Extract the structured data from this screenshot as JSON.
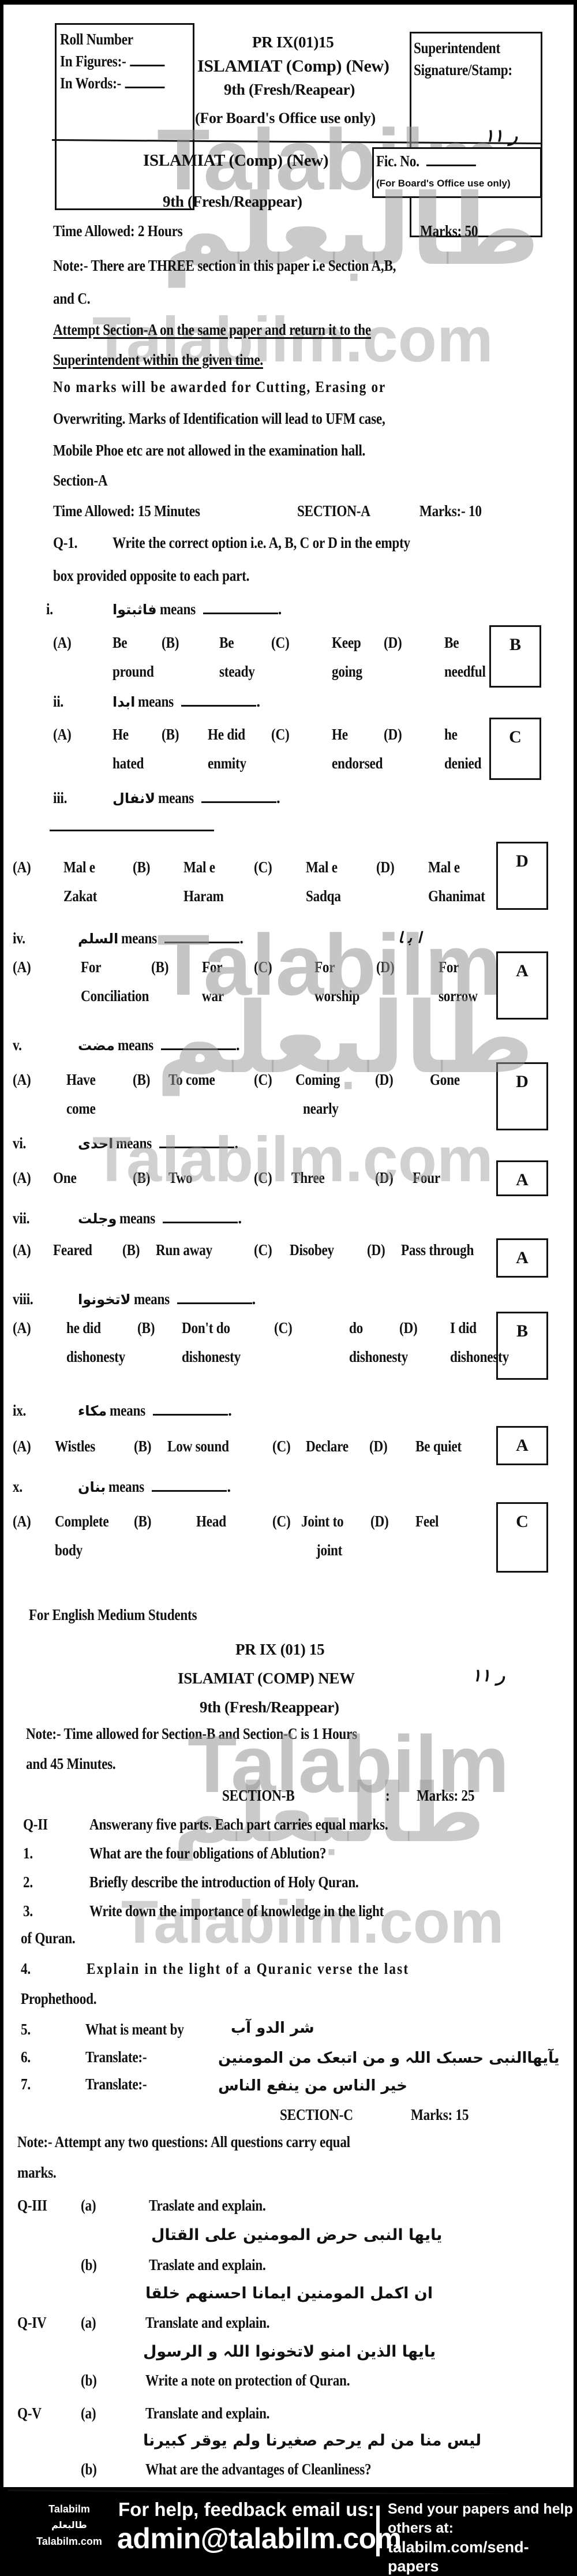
{
  "header": {
    "roll_box": {
      "title": "Roll Number",
      "figures_label": "In Figures:-",
      "words_label": "In Words:-"
    },
    "paper_code": "PR IX(01)15",
    "subject": "ISLAMIAT (Comp) (New)",
    "class": "9th (Fresh/Reapear)",
    "office_note": "(For Board's Office use only)",
    "superintendent_box": {
      "line1": "Superintendent",
      "line2": "Signature/Stamp:"
    },
    "handwritten_mark": "ﺭ ۱۱"
  },
  "section_a_header": {
    "subject": "ISLAMIAT (Comp) (New)",
    "class": "9th (Fresh/Reappear)",
    "fic_box": {
      "label": "Fic. No.",
      "note": "(For Board's Office use only)"
    },
    "time_allowed": "Time Allowed: 2 Hours",
    "marks": "Marks: 50",
    "note_line1": "Note:-  There are THREE section in this paper i.e Section A,B,",
    "note_line2": "and C.",
    "attempt_line1": "Attempt Section-A on the same paper and return it to the",
    "attempt_line2": "Superintendent within the given time.",
    "rules_line1": "No marks will be awarded for Cutting, Erasing or",
    "rules_line2": "Overwriting. Marks of Identification will lead to UFM case,",
    "rules_line3": "Mobile Phoe etc are not allowed in the examination hall.",
    "section_label": "Section-A",
    "section_time": "Time Allowed: 15 Minutes",
    "section_title": "SECTION-A",
    "section_marks": "Marks:- 10",
    "q1_num": "Q-1.",
    "q1_line1": "Write the correct option i.e. A, B, C or D in the empty",
    "q1_line2": "box provided opposite to each part."
  },
  "mcqs": [
    {
      "num": "i.",
      "arabic": "فاثبتوا",
      "means": "means",
      "options": [
        [
          "(A)",
          "Be",
          "pround"
        ],
        [
          "(B)",
          "Be",
          "steady"
        ],
        [
          "(C)",
          "Keep",
          "going"
        ],
        [
          "(D)",
          "Be",
          "needful"
        ]
      ],
      "answer": "B"
    },
    {
      "num": "ii.",
      "arabic": "ابدا",
      "means": "means",
      "options": [
        [
          "(A)",
          "He",
          "hated"
        ],
        [
          "(B)",
          "He did",
          "enmity"
        ],
        [
          "(C)",
          "He",
          "endorsed"
        ],
        [
          "(D)",
          "he",
          "denied"
        ]
      ],
      "answer": "C"
    },
    {
      "num": "iii.",
      "arabic": "لانفال",
      "means": "means",
      "options": [
        [
          "(A)",
          "Mal e",
          "Zakat"
        ],
        [
          "(B)",
          "Mal e",
          "Haram"
        ],
        [
          "(C)",
          "Mal e",
          "Sadqa"
        ],
        [
          "(D)",
          "Mal e",
          "Ghanimat"
        ]
      ],
      "answer": "D"
    },
    {
      "num": "iv.",
      "arabic": "السلم",
      "means": "means",
      "options": [
        [
          "(A)",
          "For",
          "Conciliation"
        ],
        [
          "(B)",
          "For",
          "war"
        ],
        [
          "(C)",
          "For",
          "worship"
        ],
        [
          "(D)",
          "For",
          "sorrow"
        ]
      ],
      "answer": "A"
    },
    {
      "num": "v.",
      "arabic": "مضت",
      "means": "means",
      "options": [
        [
          "(A)",
          "Have",
          "come"
        ],
        [
          "(B)",
          "To come",
          ""
        ],
        [
          "(C)",
          "Coming",
          "nearly"
        ],
        [
          "(D)",
          "Gone",
          ""
        ]
      ],
      "answer": "D"
    },
    {
      "num": "vi.",
      "arabic": "احدی",
      "means": "means",
      "options": [
        [
          "(A)",
          "One",
          ""
        ],
        [
          "(B)",
          "Two",
          ""
        ],
        [
          "(C)",
          "Three",
          ""
        ],
        [
          "(D)",
          "Four",
          ""
        ]
      ],
      "answer": "A"
    },
    {
      "num": "vii.",
      "arabic": "وجلت",
      "means": "means",
      "options": [
        [
          "(A)",
          "Feared",
          ""
        ],
        [
          "(B)",
          "Run away",
          ""
        ],
        [
          "(C)",
          "Disobey",
          ""
        ],
        [
          "(D)",
          "Pass through",
          ""
        ]
      ],
      "answer": "A"
    },
    {
      "num": "viii.",
      "arabic": "لاتخونوا",
      "means": "means",
      "options": [
        [
          "(A)",
          "he did",
          "dishonesty"
        ],
        [
          "(B)",
          "Don't do",
          "dishonesty"
        ],
        [
          "(C)",
          "do",
          "dishonesty"
        ],
        [
          "(D)",
          "I did",
          "dishonesty"
        ]
      ],
      "answer": "B"
    },
    {
      "num": "ix.",
      "arabic": "مكاء",
      "means": "means",
      "options": [
        [
          "(A)",
          "Wistles",
          ""
        ],
        [
          "(B)",
          "Low sound",
          ""
        ],
        [
          "(C)",
          "Declare",
          ""
        ],
        [
          "(D)",
          "Be quiet",
          ""
        ]
      ],
      "answer": "A"
    },
    {
      "num": "x.",
      "arabic": "بنان",
      "means": "means",
      "options": [
        [
          "(A)",
          "Complete",
          "body"
        ],
        [
          "(B)",
          "Head",
          ""
        ],
        [
          "(C)",
          "Joint to",
          "joint"
        ],
        [
          "(D)",
          "Feel",
          ""
        ]
      ],
      "answer": "C"
    }
  ],
  "part2": {
    "medium": "For English Medium Students",
    "paper_code": "PR IX (01) 15",
    "subject": "ISLAMIAT (COMP) NEW",
    "class": "9th (Fresh/Reappear)",
    "handwritten_mark": "ﺭ ۱۱",
    "note_line1": "Note:-  Time allowed for Section-B and Section-C is 1 Hours",
    "note_line2": "and 45 Minutes.",
    "section_b": {
      "title": "SECTION-B",
      "colon": ":",
      "marks": "Marks: 25",
      "q_num": "Q-II",
      "instruction": "Answerany five parts. Each part carries equal marks.",
      "items": [
        {
          "num": "1.",
          "text": "What are the four obligations of Ablution?"
        },
        {
          "num": "2.",
          "text": "Briefly describe the introduction of Holy Quran."
        },
        {
          "num": "3.",
          "text": "Write down the importance of knowledge in the light",
          "cont": "of Quran."
        },
        {
          "num": "4.",
          "text": "Explain in the light of a Quranic verse the last",
          "cont": "Prophethood."
        },
        {
          "num": "5.",
          "text": "What is meant by",
          "arabic": "شر الدو آب"
        },
        {
          "num": "6.",
          "text": "Translate:-",
          "arabic": "یآیھاالنبی حسبک اللہ و من اتبعک من المومنین"
        },
        {
          "num": "7.",
          "text": "Translate:-",
          "arabic": "خیر الناس من ینفع الناس"
        }
      ]
    },
    "section_c": {
      "title": "SECTION-C",
      "marks": "Marks: 15",
      "note_line1": "Note:-  Attempt any two questions: All questions carry equal",
      "note_line2": "marks.",
      "questions": [
        {
          "num": "Q-III",
          "parts": [
            {
              "label": "(a)",
              "text": "Traslate and explain.",
              "arabic": "یایھا النبی حرض المومنین علی القتال"
            },
            {
              "label": "(b)",
              "text": "Traslate and explain.",
              "arabic": "ان اکمل المومنین ایمانا احسنھم خلقا"
            }
          ]
        },
        {
          "num": "Q-IV",
          "parts": [
            {
              "label": "(a)",
              "text": "Translate and explain.",
              "arabic": "یایھا الذین امنو لاتخونوا اللہ و الرسول"
            },
            {
              "label": "(b)",
              "text": "Write a note on protection of Quran."
            }
          ]
        },
        {
          "num": "Q-V",
          "parts": [
            {
              "label": "(a)",
              "text": "Translate and explain.",
              "arabic": "لیس منا من لم یرحم صغیرنا ولم یوقر کبیرنا"
            },
            {
              "label": "(b)",
              "text": "What are the advantages of Cleanliness?"
            }
          ]
        }
      ]
    }
  },
  "watermarks": {
    "latin": "Talabilm",
    "latin_com": "Talabilm.com",
    "arabic": "طالبعلم"
  },
  "footer": {
    "brand_top": "Talabilm",
    "brand_ar": "طالبعلم",
    "brand_bottom": "Talabilm.com",
    "help_text": "For help, feedback email us:",
    "email": "admin@talabilm.com",
    "send_line1": "Send your papers and help",
    "send_line2": "others at:",
    "send_link": "talabilm.com/send-papers"
  }
}
